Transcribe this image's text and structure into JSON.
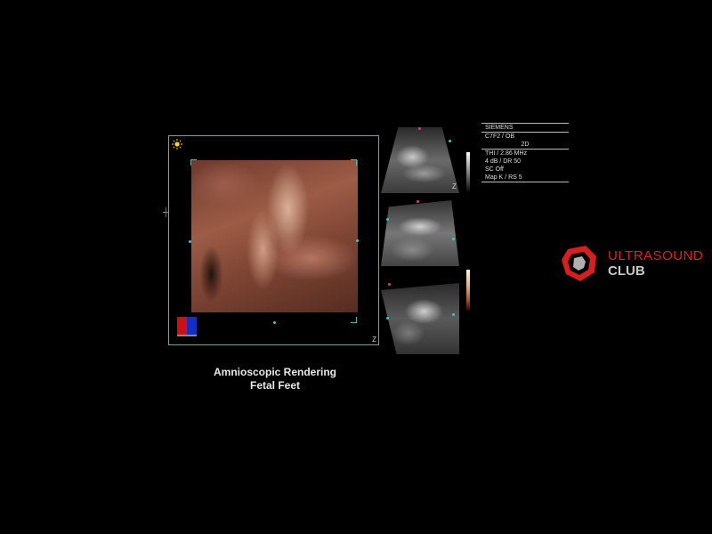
{
  "render": {
    "caption_line1": "Amnioscopic Rendering",
    "caption_line2": "Fetal Feet",
    "z_label": "Z",
    "sun_icon": "sun-icon",
    "orientation_icon": "orientation-cube-icon",
    "cube_colors": [
      "#d01010",
      "#1030c8"
    ]
  },
  "mpr": {
    "z_label": "Z",
    "markers": {
      "x": "X",
      "y": "Y"
    }
  },
  "info": {
    "vendor": "SIEMENS",
    "probe": "C7F2 / OB",
    "mode": "2D",
    "lines": [
      "THI / 2.86 MHz",
      "4 dB / DR 50",
      "SC Off",
      "Map K / RS 5"
    ]
  },
  "logo": {
    "line1": "ULTRASOUND",
    "line2": "CLUB",
    "icon": "ultrasound-club-logo",
    "accent": "#e02020"
  }
}
